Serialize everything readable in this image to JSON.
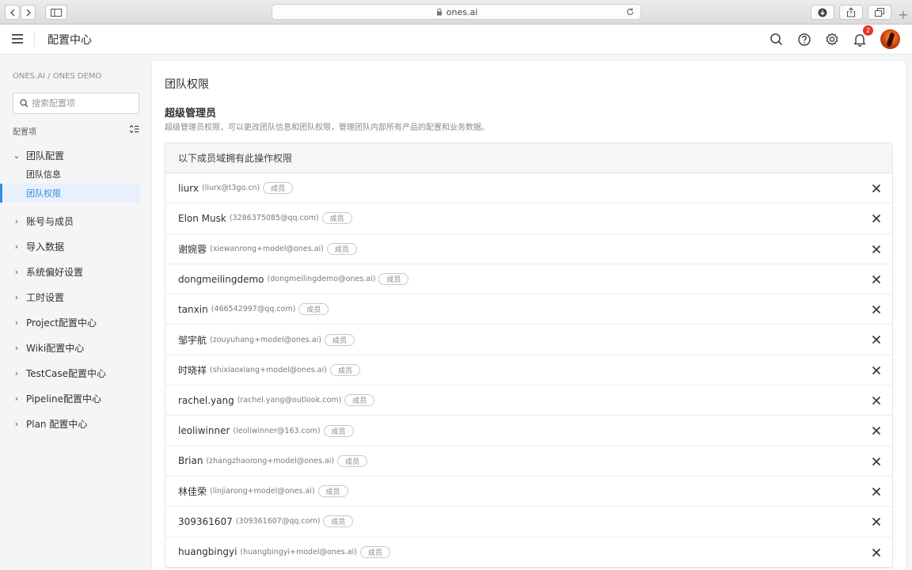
{
  "browser": {
    "url": "ones.ai"
  },
  "app": {
    "title": "配置中心",
    "notification_count": "2"
  },
  "sidebar": {
    "breadcrumb": "ONES.AI / ONES DEMO",
    "search_placeholder": "搜索配置项",
    "section_label": "配置项",
    "groups": [
      {
        "label": "团队配置",
        "expanded": true,
        "children": [
          {
            "label": "团队信息",
            "active": false
          },
          {
            "label": "团队权限",
            "active": true
          }
        ]
      },
      {
        "label": "账号与成员",
        "expanded": false
      },
      {
        "label": "导入数据",
        "expanded": false
      },
      {
        "label": "系统偏好设置",
        "expanded": false
      },
      {
        "label": "工时设置",
        "expanded": false
      },
      {
        "label": "Project配置中心",
        "expanded": false
      },
      {
        "label": "Wiki配置中心",
        "expanded": false
      },
      {
        "label": "TestCase配置中心",
        "expanded": false
      },
      {
        "label": "Pipeline配置中心",
        "expanded": false
      },
      {
        "label": "Plan 配置中心",
        "expanded": false
      }
    ]
  },
  "main": {
    "title": "团队权限",
    "section_title": "超级管理员",
    "section_desc": "超级管理员权限，可以更改团队信息和团队权限，管理团队内部所有产品的配置和业务数据。",
    "table_header": "以下成员域拥有此操作权限",
    "members": [
      {
        "name": "liurx",
        "email": "(liurx@t3go.cn)",
        "role": "成员"
      },
      {
        "name": "Elon Musk",
        "email": "(3286375085@qq.com)",
        "role": "成员"
      },
      {
        "name": "谢婉蓉",
        "email": "(xiewanrong+model@ones.ai)",
        "role": "成员"
      },
      {
        "name": "dongmeilingdemo",
        "email": "(dongmeilingdemo@ones.ai)",
        "role": "成员"
      },
      {
        "name": "tanxin",
        "email": "(466542997@qq.com)",
        "role": "成员"
      },
      {
        "name": "邹宇航",
        "email": "(zouyuhang+model@ones.ai)",
        "role": "成员"
      },
      {
        "name": "时晓祥",
        "email": "(shixiaoxiang+model@ones.ai)",
        "role": "成员"
      },
      {
        "name": "rachel.yang",
        "email": "(rachel.yang@outlook.com)",
        "role": "成员"
      },
      {
        "name": "leoliwinner",
        "email": "(leoliwinner@163.com)",
        "role": "成员"
      },
      {
        "name": "Brian",
        "email": "(zhangzhaorong+model@ones.ai)",
        "role": "成员"
      },
      {
        "name": "林佳荣",
        "email": "(linjiarong+model@ones.ai)",
        "role": "成员"
      },
      {
        "name": "309361607",
        "email": "(309361607@qq.com)",
        "role": "成员"
      },
      {
        "name": "huangbingyi",
        "email": "(huangbingyi+model@ones.ai)",
        "role": "成员"
      }
    ]
  },
  "colors": {
    "accent": "#338fe5",
    "active_bg": "#e8f0fd",
    "badge": "#e5322d"
  }
}
